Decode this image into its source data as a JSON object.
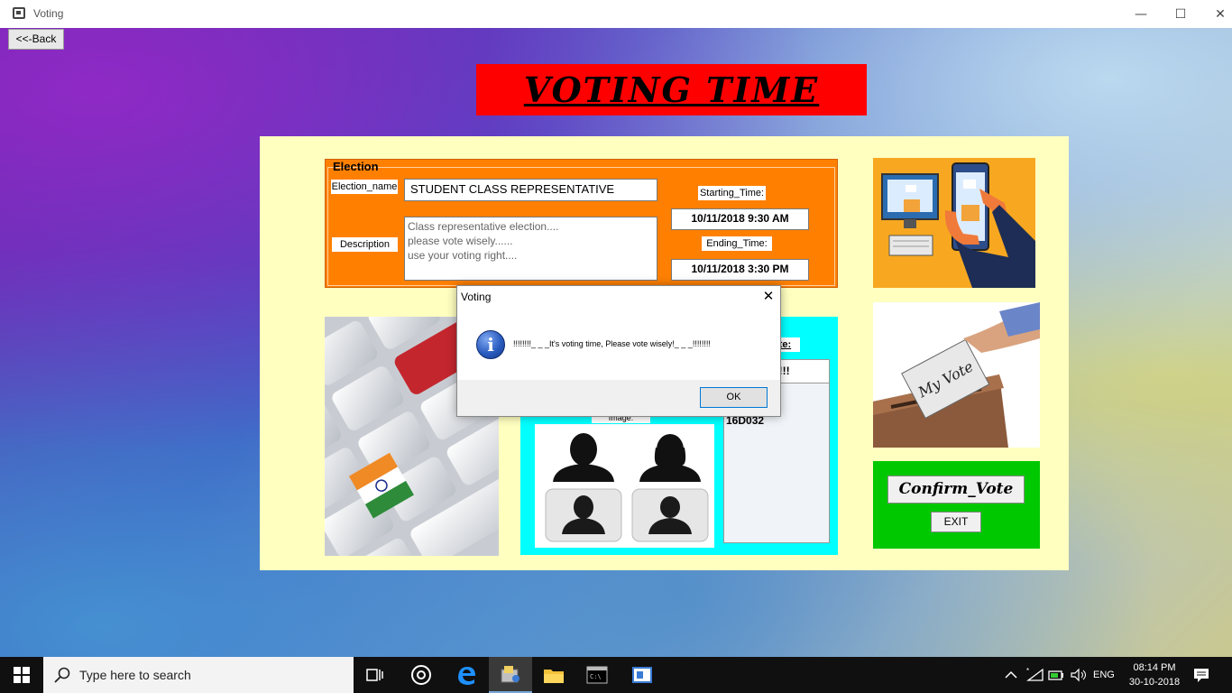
{
  "window": {
    "title": "Voting",
    "minimize": "—",
    "maximize": "☐",
    "close": "✕"
  },
  "back_button": "<<-Back",
  "banner_title": "VOTING  TIME",
  "election": {
    "group_label": "Election",
    "name_label": "Election_name",
    "name_value": "STUDENT CLASS REPRESENTATIVE",
    "description_label": "Description",
    "description_lines": [
      "Class representative election....",
      "please vote wisely......",
      "use your voting right...."
    ],
    "starting_label": "Starting_Time:",
    "starting_value": "10/11/2018 9:30 AM",
    "ending_label": "Ending_Time:",
    "ending_value": "10/11/2018 3:30 PM"
  },
  "candidate_panel": {
    "vote_label_fragment": "ote:",
    "list_header_fragment": "s!!!",
    "id_fragment": "16D032",
    "image_label": "Image:"
  },
  "images": {
    "top_right": "VOTE",
    "ballot_text": "My Vote"
  },
  "buttons": {
    "confirm": "Confirm_Vote",
    "exit": "EXIT"
  },
  "dialog": {
    "title": "Voting",
    "close": "✕",
    "message": "!!!!!!!!_ _ _It's voting time, Please vote wisely!_ _ _!!!!!!!!",
    "ok": "OK"
  },
  "taskbar": {
    "search_placeholder": "Type here to search",
    "language": "ENG",
    "time": "08:14 PM",
    "date": "30-10-2018"
  },
  "colors": {
    "banner": "#ff0000",
    "panel": "#ffffc0",
    "election": "#ff8000",
    "cyan": "#00ffff",
    "green": "#00c800"
  }
}
